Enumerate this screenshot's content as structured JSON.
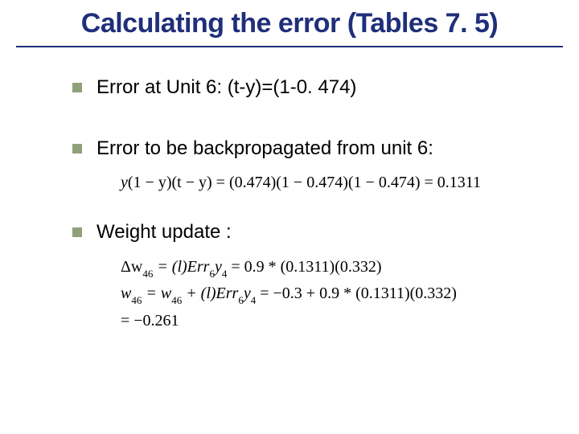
{
  "title": "Calculating the error (Tables 7. 5)",
  "bullets": [
    {
      "text": "Error at Unit 6:  (t-y)=(1-0. 474)"
    },
    {
      "text": "Error to be backpropagated from unit 6:"
    },
    {
      "text": "Weight update :"
    }
  ],
  "formulas": {
    "backprop": {
      "lhs_var": "y",
      "expr1": "(1 − y)",
      "expr2": "(t − y)",
      "eq": " = ",
      "num1": "(0.474)",
      "num2": "(1 − 0.474)",
      "num3": "(1 − 0.474)",
      "result": " = 0.1311"
    },
    "weight": {
      "l1_lhs_sym": "Δw",
      "l1_lhs_sub": "46",
      "l1_rhs_a": " = (l)Err",
      "l1_rhs_a_sub": "6",
      "l1_rhs_b": "y",
      "l1_rhs_b_sub": "4",
      "l1_rhs_c": " = 0.9 * (0.1311)(0.332)",
      "l2_lhs_sym": "w",
      "l2_lhs_sub": "46",
      "l2_rhs_a": " = w",
      "l2_rhs_a_sub": "46",
      "l2_rhs_b": " + (l)Err",
      "l2_rhs_b_sub": "6",
      "l2_rhs_c": "y",
      "l2_rhs_c_sub": "4",
      "l2_rhs_d": " = −0.3 + 0.9 * (0.1311)(0.332)",
      "l3": "= −0.261"
    }
  }
}
